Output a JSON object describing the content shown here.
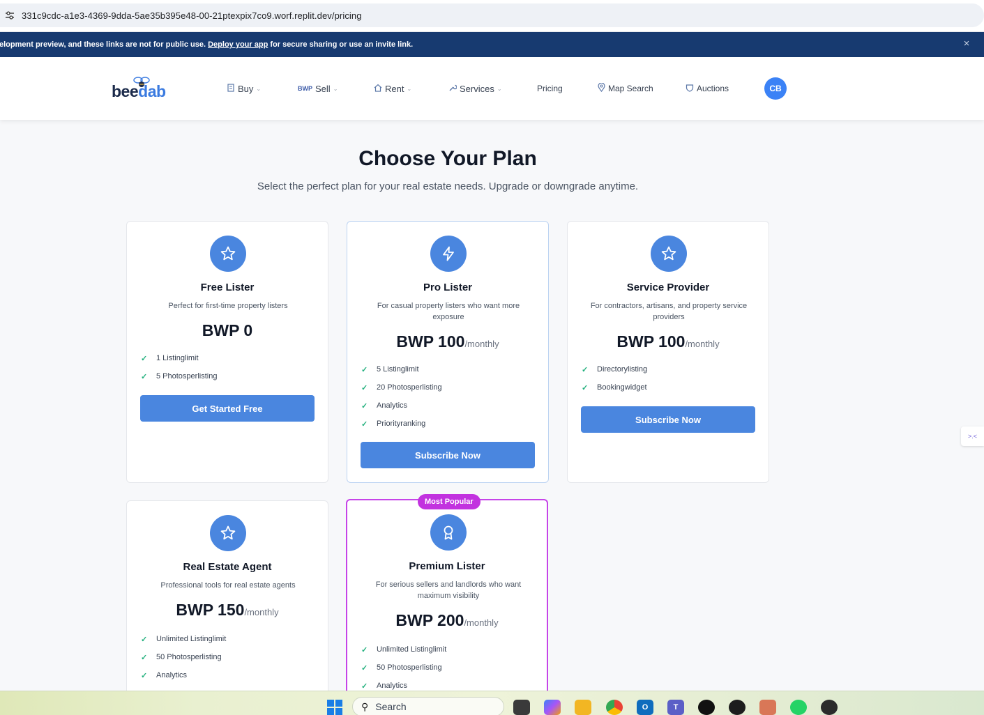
{
  "browser": {
    "url": "331c9cdc-a1e3-4369-9dda-5ae35b395e48-00-21ptexpix7co9.worf.replit.dev/pricing"
  },
  "dev_banner": {
    "text_before": "elopment preview, and these links are not for public use. ",
    "link": "Deploy your app",
    "text_after": " for secure sharing or use an invite link.",
    "close": "×"
  },
  "header": {
    "logo_prefix": "bee",
    "logo_suffix": "dab",
    "nav": [
      {
        "label": "Buy",
        "icon": "building-icon",
        "dropdown": true
      },
      {
        "label": "Sell",
        "tag": "BWP",
        "dropdown": true
      },
      {
        "label": "Rent",
        "icon": "home-icon",
        "dropdown": true
      },
      {
        "label": "Services",
        "icon": "wrench-icon",
        "dropdown": true
      },
      {
        "label": "Pricing",
        "dropdown": false
      },
      {
        "label": "Map Search",
        "icon": "map-pin-icon",
        "dropdown": false
      },
      {
        "label": "Auctions",
        "icon": "gavel-icon",
        "dropdown": false
      }
    ],
    "avatar_initials": "CB"
  },
  "page": {
    "title": "Choose Your Plan",
    "subtitle": "Select the perfect plan for your real estate needs. Upgrade or downgrade anytime."
  },
  "plans": [
    {
      "name": "Free Lister",
      "icon": "star-icon",
      "description": "Perfect for first-time property listers",
      "price": "BWP 0",
      "period": "",
      "features": [
        "1 Listinglimit",
        "5 Photosperlisting"
      ],
      "cta": "Get Started Free"
    },
    {
      "name": "Pro Lister",
      "icon": "lightning-icon",
      "description": "For casual property listers who want more exposure",
      "price": "BWP 100",
      "period": "/monthly",
      "features": [
        "5 Listinglimit",
        "20 Photosperlisting",
        "Analytics",
        "Priorityranking"
      ],
      "cta": "Subscribe Now"
    },
    {
      "name": "Service Provider",
      "icon": "star-icon",
      "description": "For contractors, artisans, and property service providers",
      "price": "BWP 100",
      "period": "/monthly",
      "features": [
        "Directorylisting",
        "Bookingwidget"
      ],
      "cta": "Subscribe Now"
    },
    {
      "name": "Real Estate Agent",
      "icon": "star-icon",
      "description": "Professional tools for real estate agents",
      "price": "BWP 150",
      "period": "/monthly",
      "features": [
        "Unlimited Listinglimit",
        "50 Photosperlisting",
        "Analytics"
      ]
    },
    {
      "name": "Premium Lister",
      "icon": "award-icon",
      "badge": "Most Popular",
      "description": "For serious sellers and landlords who want maximum visibility",
      "price": "BWP 200",
      "period": "/monthly",
      "features": [
        "Unlimited Listinglimit",
        "50 Photosperlisting",
        "Analytics"
      ]
    }
  ],
  "taskbar": {
    "search_label": "Search",
    "apps": [
      "task-view-icon",
      "copilot-icon",
      "file-explorer-icon",
      "chrome-icon",
      "outlook-icon",
      "teams-icon",
      "chatgpt-icon",
      "app-icon",
      "claude-icon",
      "whatsapp-icon",
      "media-player-icon"
    ]
  },
  "colors": {
    "accent": "#4a86df",
    "banner": "#173a70",
    "popular": "#c232df",
    "check": "#22b07d"
  }
}
